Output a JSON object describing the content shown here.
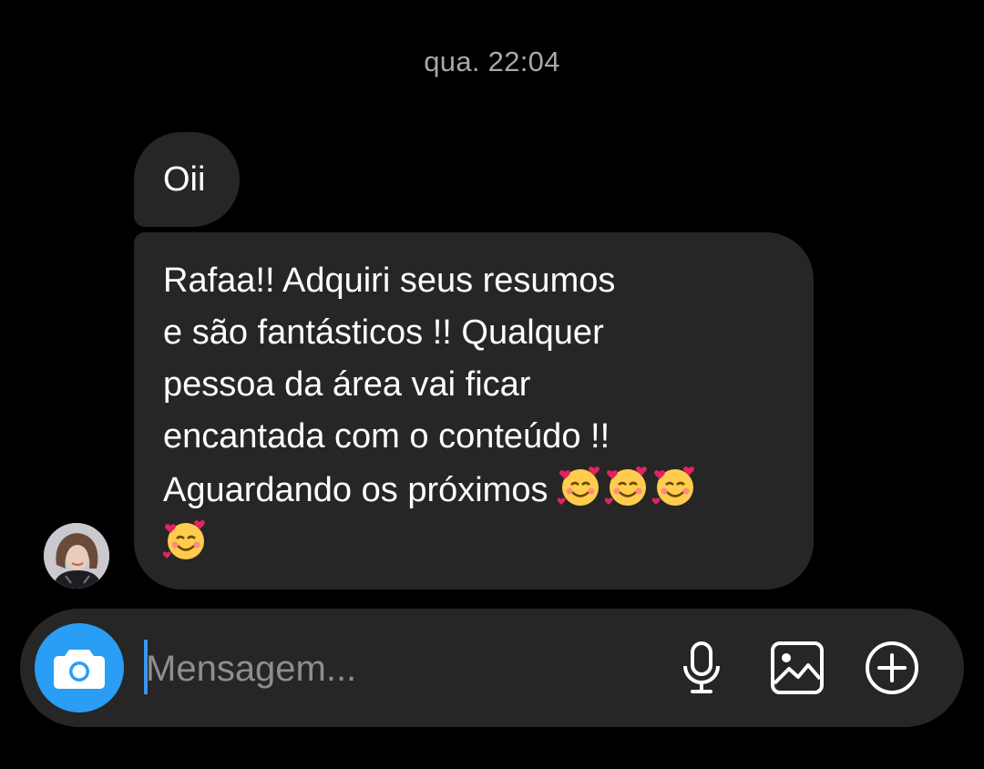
{
  "thread": {
    "timestamp": "qua. 22:04",
    "messages": [
      {
        "text": "Oii"
      },
      {
        "text": "Rafaa!! Adquiri seus resumos\ne são fantásticos !! Qualquer\npessoa da área vai ficar\nencantada com o conteúdo !!\nAguardando os próximos ",
        "emoji": "🥰🥰🥰🥰",
        "emoji_icon": "smiling-face-with-hearts-icon"
      }
    ]
  },
  "composer": {
    "placeholder": "Mensagem...",
    "value": "",
    "icons": [
      "camera-icon",
      "microphone-icon",
      "image-icon",
      "plus-circle-icon"
    ],
    "camera_color": "#2a9df4"
  }
}
